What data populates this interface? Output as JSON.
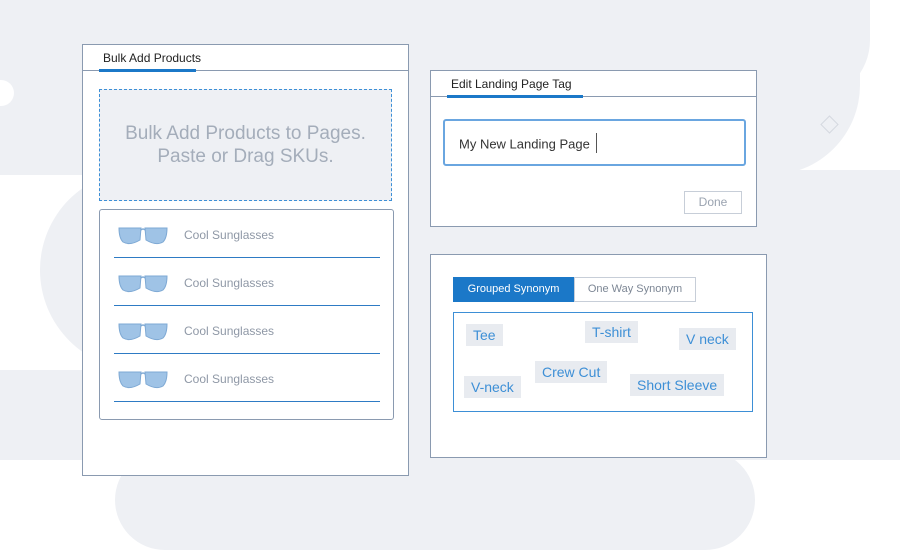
{
  "bulk_add": {
    "title": "Bulk Add Products",
    "dropzone_line1": "Bulk Add Products to Pages.",
    "dropzone_line2": "Paste or Drag SKUs.",
    "products": [
      {
        "name": "Cool Sunglasses",
        "icon": "sunglasses-icon"
      },
      {
        "name": "Cool Sunglasses",
        "icon": "sunglasses-icon"
      },
      {
        "name": "Cool Sunglasses",
        "icon": "sunglasses-icon"
      },
      {
        "name": "Cool Sunglasses",
        "icon": "sunglasses-icon"
      }
    ]
  },
  "edit_tag": {
    "title": "Edit Landing Page Tag",
    "input_value": "My New Landing Page",
    "done_label": "Done"
  },
  "synonyms": {
    "tabs": [
      {
        "label": "Grouped Synonym",
        "active": true
      },
      {
        "label": "One Way Synonym",
        "active": false
      }
    ],
    "terms": [
      "Tee",
      "T-shirt",
      "V neck",
      "Crew Cut",
      "V-neck",
      "Short Sleeve"
    ]
  },
  "colors": {
    "accent": "#1b78c8",
    "border": "#8a9ab0",
    "background_shape": "#eef0f4"
  }
}
